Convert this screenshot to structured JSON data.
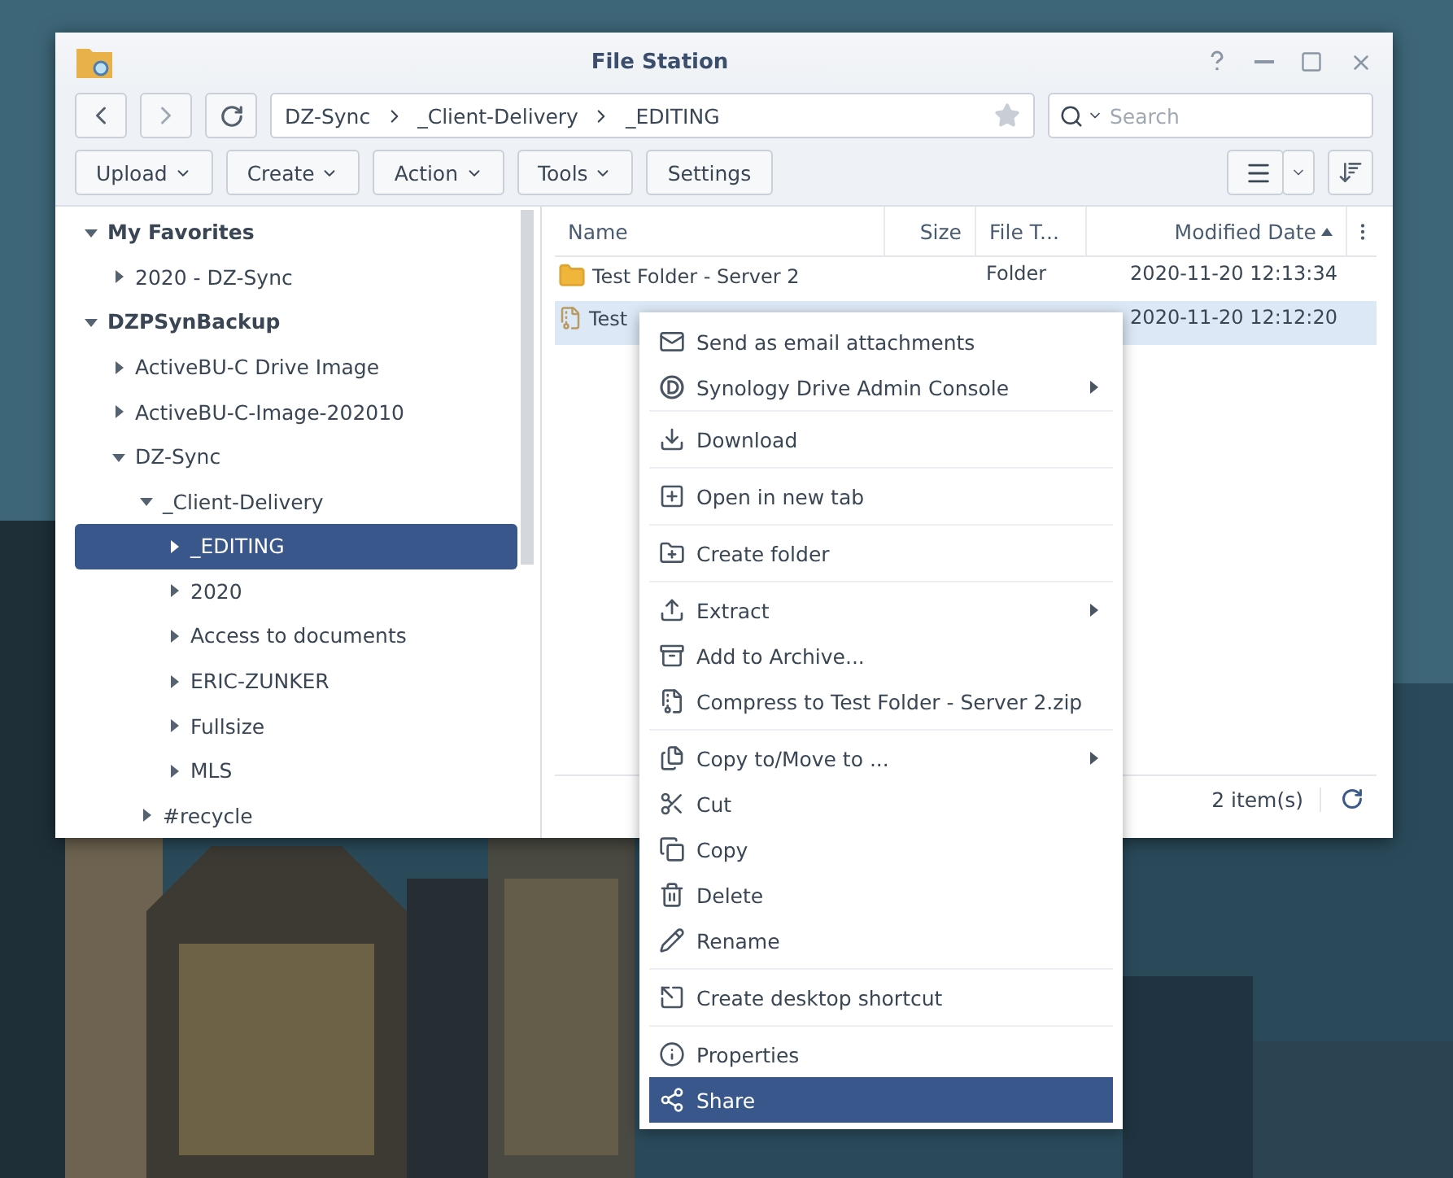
{
  "window": {
    "title": "File Station"
  },
  "nav": {
    "path": [
      {
        "label": "DZ-Sync"
      },
      {
        "label": "_Client-Delivery"
      },
      {
        "label": "_EDITING"
      }
    ],
    "search": {
      "placeholder": "Search"
    }
  },
  "toolbar": {
    "buttons": [
      {
        "label": "Upload",
        "dropdown": true
      },
      {
        "label": "Create",
        "dropdown": true
      },
      {
        "label": "Action",
        "dropdown": true
      },
      {
        "label": "Tools",
        "dropdown": true
      },
      {
        "label": "Settings",
        "dropdown": false
      }
    ]
  },
  "sidebar": {
    "sections": [
      {
        "label": "My Favorites",
        "expanded": true,
        "selected": false,
        "children": [
          {
            "label": "2020 - DZ-Sync",
            "expanded": false,
            "selected": false
          }
        ]
      },
      {
        "label": "DZPSynBackup",
        "expanded": true,
        "selected": false,
        "children": [
          {
            "label": "ActiveBU-C Drive Image",
            "expanded": false,
            "selected": false
          },
          {
            "label": "ActiveBU-C-Image-202010",
            "expanded": false,
            "selected": false
          },
          {
            "label": "DZ-Sync",
            "expanded": true,
            "selected": false,
            "children": [
              {
                "label": "_Client-Delivery",
                "expanded": true,
                "selected": false,
                "children": [
                  {
                    "label": "_EDITING",
                    "expanded": false,
                    "selected": true
                  },
                  {
                    "label": "2020",
                    "expanded": false,
                    "selected": false
                  },
                  {
                    "label": "Access to documents",
                    "expanded": false,
                    "selected": false
                  },
                  {
                    "label": "ERIC-ZUNKER",
                    "expanded": false,
                    "selected": false
                  },
                  {
                    "label": "Fullsize",
                    "expanded": false,
                    "selected": false
                  },
                  {
                    "label": "MLS",
                    "expanded": false,
                    "selected": false
                  }
                ]
              },
              {
                "label": "#recycle",
                "expanded": false,
                "selected": false
              }
            ]
          }
        ]
      }
    ]
  },
  "table": {
    "columns": [
      {
        "label": "Name",
        "sorted": false
      },
      {
        "label": "Size",
        "sorted": false
      },
      {
        "label": "File T...",
        "sorted": false
      },
      {
        "label": "Modified Date",
        "sorted": true
      }
    ],
    "rows": [
      {
        "kind": "folder",
        "name": "Test Folder - Server 2",
        "type": "Folder",
        "modified": "2020-11-20 12:13:34",
        "selected": false
      },
      {
        "kind": "zip",
        "name": "Test",
        "modified": "2020-11-20 12:12:20",
        "selected": true
      }
    ]
  },
  "status_bar": {
    "count": "2 item(s)"
  },
  "context_menu": {
    "groups": [
      [
        {
          "label": "Send as email attachments",
          "submenu": false,
          "selected": false
        },
        {
          "label": "Synology Drive Admin Console",
          "submenu": true,
          "selected": false
        }
      ],
      [
        {
          "label": "Download",
          "submenu": false,
          "selected": false
        }
      ],
      [
        {
          "label": "Open in new tab",
          "submenu": false,
          "selected": false
        }
      ],
      [
        {
          "label": "Create folder",
          "submenu": false,
          "selected": false
        }
      ],
      [
        {
          "label": "Extract",
          "submenu": true,
          "selected": false
        },
        {
          "label": "Add to Archive...",
          "submenu": false,
          "selected": false
        },
        {
          "label": "Compress to Test Folder - Server 2.zip",
          "submenu": false,
          "selected": false
        }
      ],
      [
        {
          "label": "Copy to/Move to ...",
          "submenu": true,
          "selected": false
        },
        {
          "label": "Cut",
          "submenu": false,
          "selected": false
        },
        {
          "label": "Copy",
          "submenu": false,
          "selected": false
        },
        {
          "label": "Delete",
          "submenu": false,
          "selected": false
        },
        {
          "label": "Rename",
          "submenu": false,
          "selected": false
        }
      ],
      [
        {
          "label": "Create desktop shortcut",
          "submenu": false,
          "selected": false
        }
      ],
      [
        {
          "label": "Properties",
          "submenu": false,
          "selected": false
        },
        {
          "label": "Share",
          "submenu": false,
          "selected": true
        }
      ]
    ]
  }
}
